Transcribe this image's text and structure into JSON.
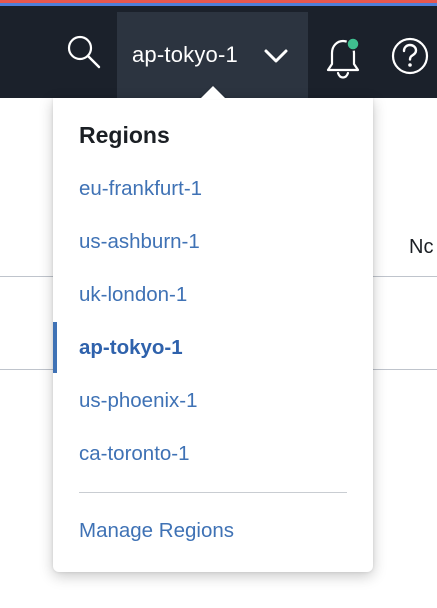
{
  "header": {
    "current_region": "ap-tokyo-1",
    "notification_dot_color": "#3fbf8f",
    "icons": {
      "search": "search-icon",
      "chevron": "chevron-down-icon",
      "bell": "bell-icon",
      "help": "help-icon"
    }
  },
  "background": {
    "column_header_partial": "Nc"
  },
  "dropdown": {
    "title": "Regions",
    "items": [
      {
        "label": "eu-frankfurt-1",
        "selected": false
      },
      {
        "label": "us-ashburn-1",
        "selected": false
      },
      {
        "label": "uk-london-1",
        "selected": false
      },
      {
        "label": "ap-tokyo-1",
        "selected": true
      },
      {
        "label": "us-phoenix-1",
        "selected": false
      },
      {
        "label": "ca-toronto-1",
        "selected": false
      }
    ],
    "manage_link": "Manage Regions"
  },
  "colors": {
    "header_bg": "#1b212b",
    "selector_bg": "#2c3440",
    "link": "#3f72b5",
    "accent_red": "#e8574f",
    "accent_blue": "#4f7fd9"
  }
}
